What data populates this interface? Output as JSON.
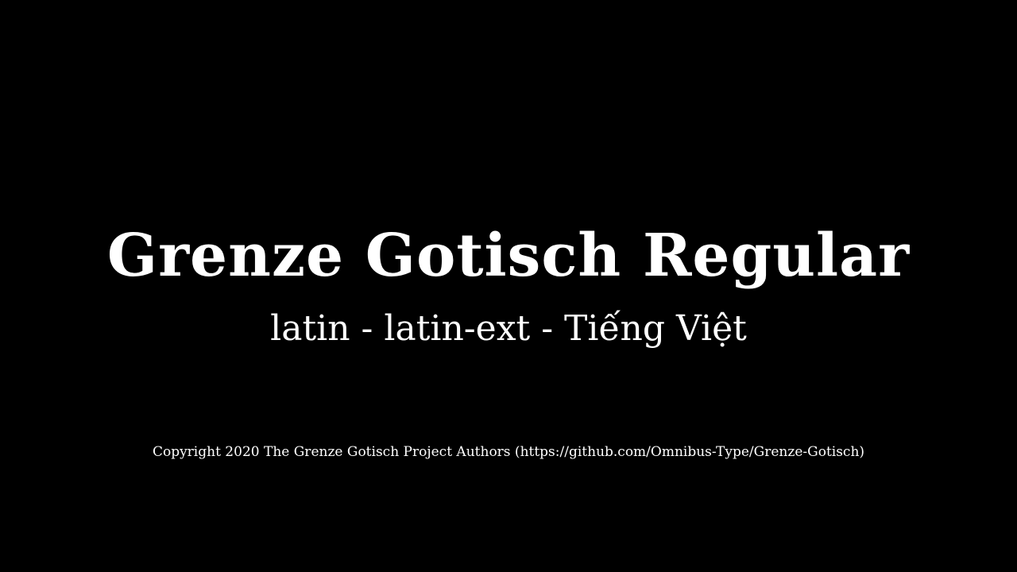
{
  "title": "Grenze Gotisch Regular",
  "subtitle": "latin - latin-ext - Tiếng Việt",
  "copyright": "Copyright 2020 The Grenze Gotisch Project Authors (https://github.com/Omnibus-Type/Grenze-Gotisch)",
  "colors": {
    "background": "#000000",
    "text": "#ffffff"
  }
}
